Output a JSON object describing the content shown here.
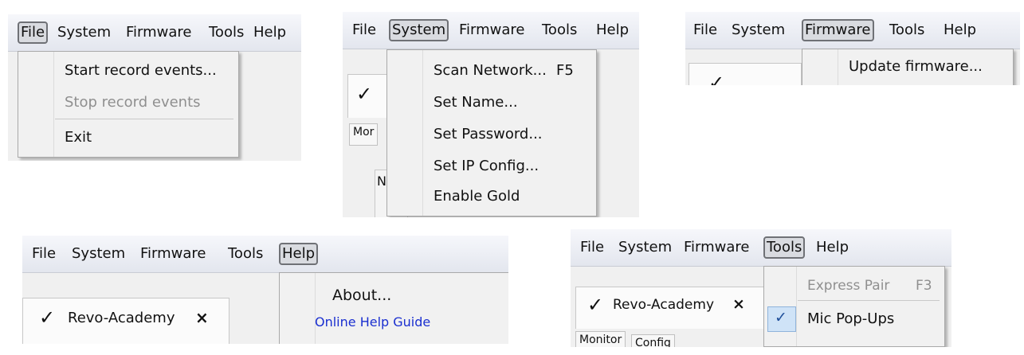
{
  "panel_file": {
    "menubar": [
      "File",
      "System",
      "Firmware",
      "Tools",
      "Help"
    ],
    "menu_items": [
      "Start record events...",
      "Stop record events",
      "Exit"
    ]
  },
  "panel_system": {
    "menubar": [
      "File",
      "System",
      "Firmware",
      "Tools",
      "Help"
    ],
    "menu_items": [
      "Scan Network...",
      "Set Name...",
      "Set  Password...",
      "Set IP Config...",
      "Enable Gold"
    ],
    "shortcut": "F5",
    "background_tab_fragment": "Mor",
    "background_fragment": "N"
  },
  "panel_firmware": {
    "menubar": [
      "File",
      "System",
      "Firmware",
      "Tools",
      "Help"
    ],
    "menu_items": [
      "Update firmware..."
    ]
  },
  "panel_help": {
    "menubar": [
      "File",
      "System",
      "Firmware",
      "Tools",
      "Help"
    ],
    "tab_label": "Revo-Academy",
    "tab_close": "×",
    "check": "✓",
    "menu_items": [
      "About...",
      "Online Help Guide"
    ]
  },
  "panel_tools": {
    "menubar": [
      "File",
      "System",
      "Firmware",
      "Tools",
      "Help"
    ],
    "tab_label": "Revo-Academy",
    "tab_close": "×",
    "check": "✓",
    "menu_items": [
      "Express Pair",
      "Mic Pop-Ups"
    ],
    "express_shortcut": "F3",
    "mic_checked": "✓",
    "bottom_tabs": [
      "Monitor",
      "Config"
    ]
  }
}
